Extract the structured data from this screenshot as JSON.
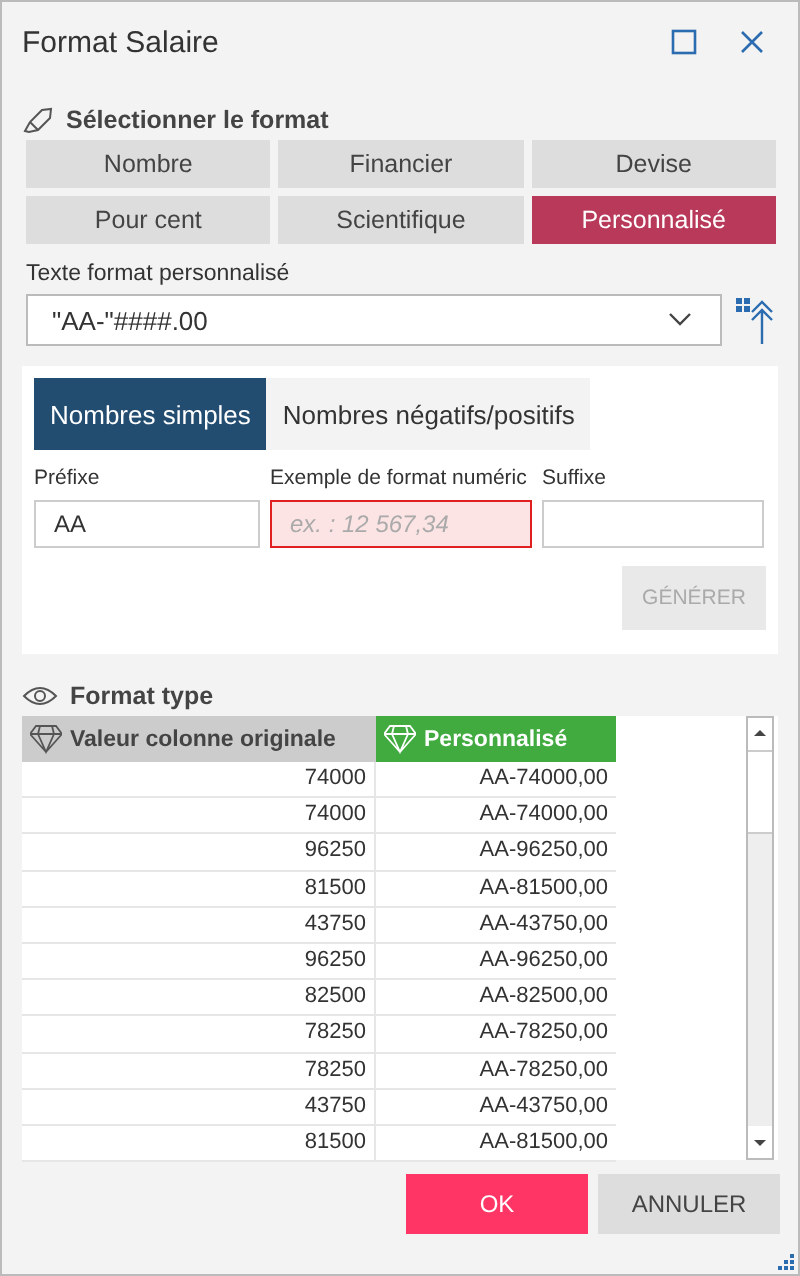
{
  "window": {
    "title": "Format Salaire"
  },
  "format_section": {
    "title": "Sélectionner le format",
    "options": [
      {
        "label": "Nombre",
        "selected": false
      },
      {
        "label": "Financier",
        "selected": false
      },
      {
        "label": "Devise",
        "selected": false
      },
      {
        "label": "Pour cent",
        "selected": false
      },
      {
        "label": "Scientifique",
        "selected": false
      },
      {
        "label": "Personnalisé",
        "selected": true
      }
    ]
  },
  "custom_format": {
    "label": "Texte format personnalisé",
    "value": "\"AA-\"####.00"
  },
  "tabs": [
    {
      "label": "Nombres simples",
      "selected": true
    },
    {
      "label": "Nombres négatifs/positifs",
      "selected": false
    }
  ],
  "fields": [
    {
      "label": "Préfixe",
      "value": "AA",
      "invalid": false
    },
    {
      "label": "Exemple de format numéric",
      "placeholder": "ex. : 12 567,34",
      "invalid": true
    },
    {
      "label": "Suffixe",
      "invalid": false
    }
  ],
  "generate_button": {
    "label": "GÉNÉRER",
    "disabled": true
  },
  "preview": {
    "title": "Format type",
    "columns": [
      "Valeur colonne originale",
      "Personnalisé"
    ],
    "rows": [
      [
        "74000",
        "AA-74000,00"
      ],
      [
        "74000",
        "AA-74000,00"
      ],
      [
        "96250",
        "AA-96250,00"
      ],
      [
        "81500",
        "AA-81500,00"
      ],
      [
        "43750",
        "AA-43750,00"
      ],
      [
        "96250",
        "AA-96250,00"
      ],
      [
        "82500",
        "AA-82500,00"
      ],
      [
        "78250",
        "AA-78250,00"
      ],
      [
        "78250",
        "AA-78250,00"
      ],
      [
        "43750",
        "AA-43750,00"
      ],
      [
        "81500",
        "AA-81500,00"
      ]
    ]
  },
  "buttons": [
    {
      "label": "OK",
      "kind": "primary"
    },
    {
      "label": "ANNULER",
      "kind": "secondary"
    }
  ]
}
